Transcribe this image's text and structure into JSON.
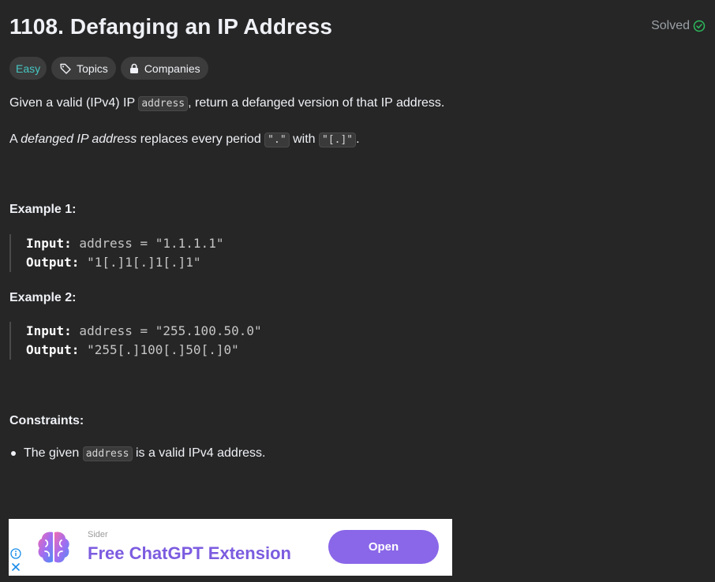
{
  "problem": {
    "title": "1108. Defanging an IP Address",
    "status": "Solved"
  },
  "tags": {
    "difficulty": "Easy",
    "topics": "Topics",
    "companies": "Companies"
  },
  "description": {
    "p1_before": "Given a valid (IPv4) IP ",
    "p1_code": "address",
    "p1_after": ", return a defanged version of that IP address.",
    "p2_before": "A ",
    "p2_em": "defanged IP address",
    "p2_mid": " replaces every period ",
    "p2_code1": "\".\"",
    "p2_with": " with ",
    "p2_code2": "\"[.]\"",
    "p2_end": "."
  },
  "examples": [
    {
      "heading": "Example 1:",
      "input_label": "Input:",
      "input_value": " address = \"1.1.1.1\"",
      "output_label": "Output:",
      "output_value": " \"1[.]1[.]1[.]1\""
    },
    {
      "heading": "Example 2:",
      "input_label": "Input:",
      "input_value": " address = \"255.100.50.0\"",
      "output_label": "Output:",
      "output_value": " \"255[.]100[.]50[.]0\""
    }
  ],
  "constraints": {
    "heading": "Constraints:",
    "item_before": "The given ",
    "item_code": "address",
    "item_after": " is a valid IPv4 address."
  },
  "ad": {
    "brand": "Sider",
    "headline": "Free ChatGPT Extension",
    "button": "Open"
  },
  "colors": {
    "background": "#262626",
    "easy": "#46c6c2",
    "solved_check": "#2cbb5d",
    "ad_accent": "#8a67e8"
  },
  "icons": [
    "check-circle-icon",
    "tag-icon",
    "lock-icon",
    "info-icon",
    "close-icon",
    "brain-icon"
  ]
}
